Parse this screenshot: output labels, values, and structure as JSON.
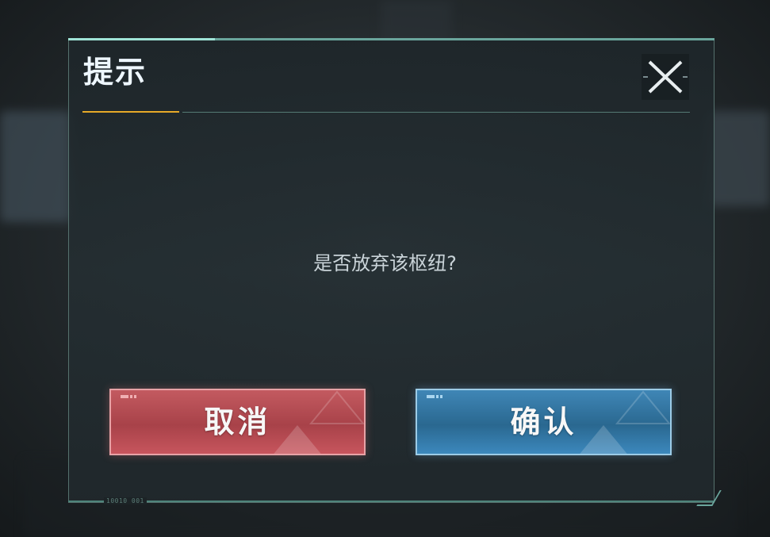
{
  "dialog": {
    "title": "提示",
    "message": "是否放弃该枢纽?",
    "serial": "10010 001",
    "close_icon": "close-x-icon"
  },
  "buttons": {
    "cancel_label": "取消",
    "confirm_label": "确认"
  },
  "colors": {
    "accent_gold": "#e6a928",
    "frame_teal": "#6aa59c",
    "cancel_red": "#a84249",
    "confirm_blue": "#2a6890"
  }
}
